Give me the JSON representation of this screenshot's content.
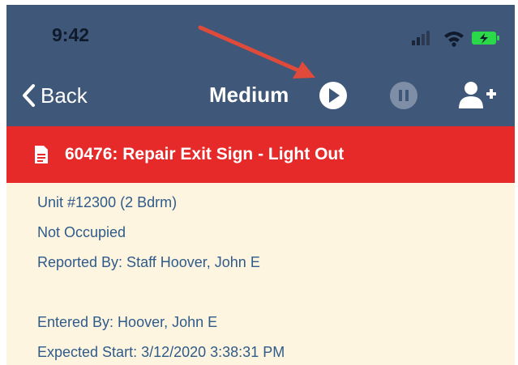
{
  "status_bar": {
    "time": "9:42",
    "icons": [
      "signal-icon",
      "wifi-icon",
      "battery-icon"
    ]
  },
  "nav": {
    "back_label": "Back",
    "title": "Medium",
    "buttons": [
      "play-icon",
      "pause-icon",
      "add-user-icon"
    ]
  },
  "work_order": {
    "title": "60476: Repair Exit Sign - Light Out"
  },
  "details": {
    "unit": "Unit #12300 (2 Bdrm)",
    "occupancy": "Not Occupied",
    "reported_by": "Reported By: Staff Hoover, John E",
    "entered_by": "Entered By: Hoover, John E",
    "expected_start": "Expected Start: 3/12/2020 3:38:31 PM"
  },
  "colors": {
    "nav_background": "#3f5778",
    "banner": "#e62a2a",
    "details_background": "#fdf5df",
    "detail_text": "#2f5b8a",
    "annotation_arrow": "#e04a3a"
  }
}
